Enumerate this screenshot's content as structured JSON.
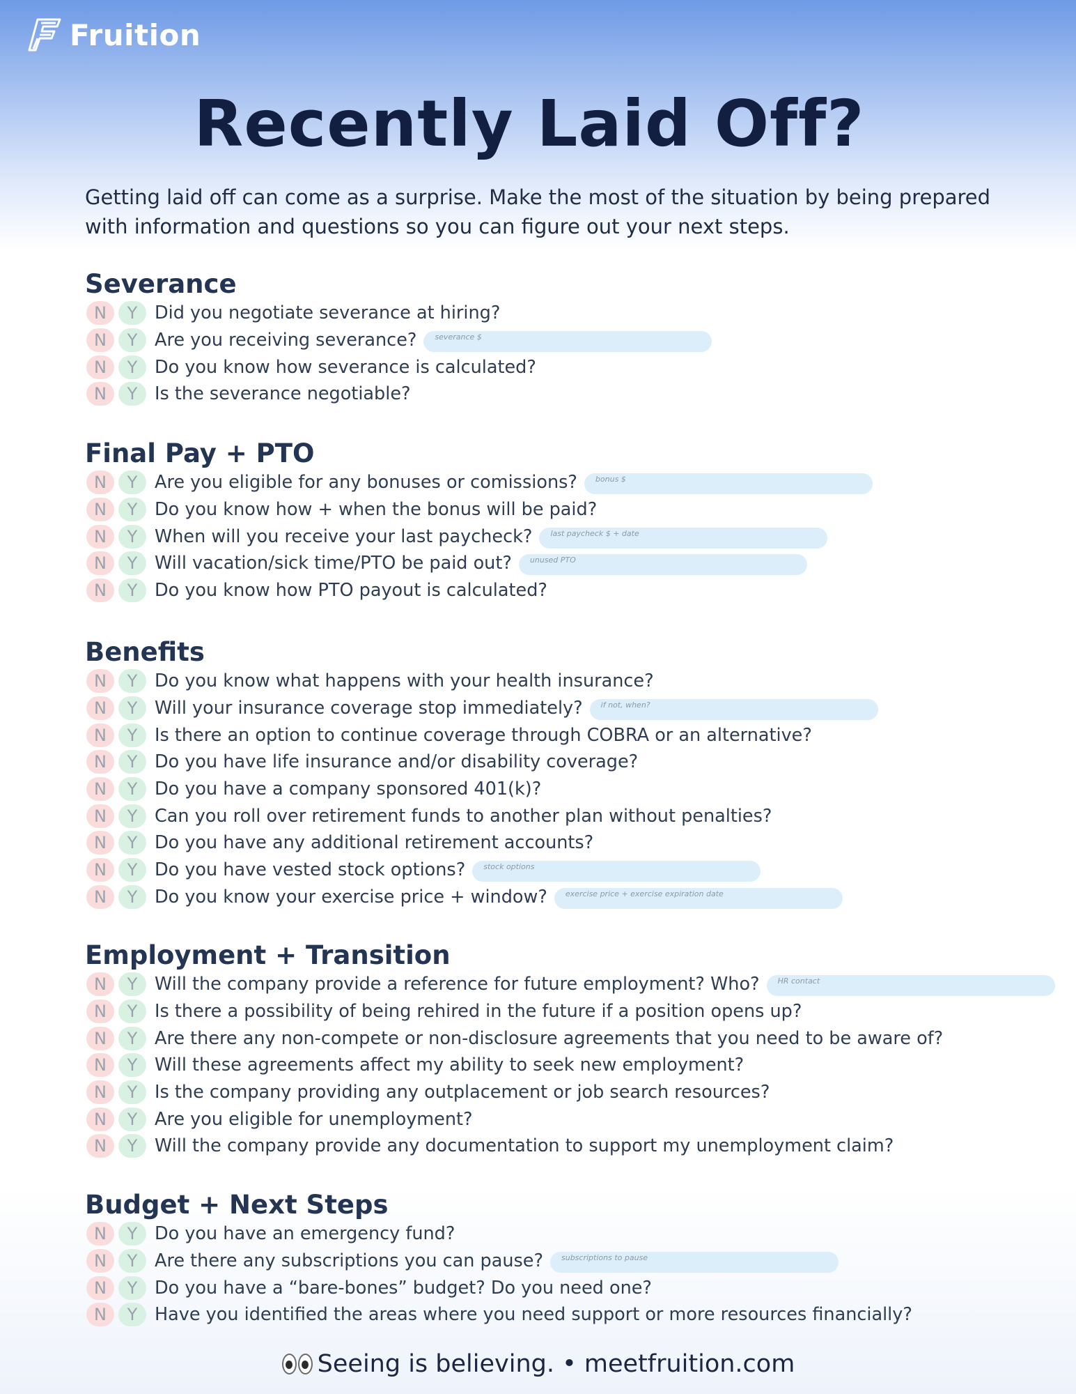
{
  "brand": {
    "name": "Fruition",
    "icon": "fruition-f-logo-icon"
  },
  "title": "Recently Laid Off?",
  "intro": "Getting laid off can come as a surprise. Make the most of the situation by being prepared with information and questions so you can figure out your next steps.",
  "chips": {
    "no": "N",
    "yes": "Y"
  },
  "sections": [
    {
      "heading": "Severance",
      "items": [
        {
          "q": "Did you negotiate severance at hiring?"
        },
        {
          "q": "Are you receiving severance?",
          "field": "severance $"
        },
        {
          "q": "Do you know how severance is calculated?"
        },
        {
          "q": "Is the severance negotiable?"
        }
      ]
    },
    {
      "heading": "Final Pay + PTO",
      "items": [
        {
          "q": "Are you eligible for any bonuses or comissions?",
          "field": "bonus $"
        },
        {
          "q": "Do you know how + when the bonus will be paid?"
        },
        {
          "q": "When will you receive your last paycheck?",
          "field": "last paycheck $ + date"
        },
        {
          "q": "Will vacation/sick time/PTO be paid out?",
          "field": "unused PTO"
        },
        {
          "q": "Do you know how PTO payout is calculated?"
        }
      ]
    },
    {
      "heading": "Benefits",
      "items": [
        {
          "q": "Do you know what happens with your health insurance?"
        },
        {
          "q": "Will your insurance coverage stop immediately?",
          "field": "if not, when?"
        },
        {
          "q": "Is there an option to continue coverage through COBRA or an alternative?"
        },
        {
          "q": "Do you have life insurance and/or disability coverage?"
        },
        {
          "q": "Do you have a company sponsored 401(k)?"
        },
        {
          "q": "Can you roll over retirement funds to another plan without penalties?"
        },
        {
          "q": "Do you have any additional retirement accounts?"
        },
        {
          "q": "Do you have vested stock options?",
          "field": "stock options"
        },
        {
          "q": "Do you know your exercise price + window?",
          "field": "exercise price + exercise expiration date"
        }
      ]
    },
    {
      "heading": "Employment + Transition",
      "items": [
        {
          "q": "Will the company provide a reference for future employment? Who?",
          "field": "HR contact"
        },
        {
          "q": "Is there a possibility of being rehired in the future if a position opens up?"
        },
        {
          "q": "Are there any non-compete or non-disclosure agreements that you need to be aware of?"
        },
        {
          "q": "Will these agreements affect my ability to seek new employment?"
        },
        {
          "q": "Is the company providing any outplacement or job search resources?"
        },
        {
          "q": "Are you eligible for unemployment?"
        },
        {
          "q": "Will the company provide any documentation to support my unemployment claim?"
        }
      ]
    },
    {
      "heading": "Budget + Next Steps",
      "items": [
        {
          "q": "Do you have an emergency fund?"
        },
        {
          "q": "Are there any subscriptions you can pause?",
          "field": "subscriptions to pause"
        },
        {
          "q": "Do you have a “bare-bones” budget? Do you need one?"
        },
        {
          "q": "Have you identified the areas where you need support or more resources financially?"
        }
      ]
    }
  ],
  "footer": {
    "text": "Seeing is believing. • meetfruition.com",
    "icon": "eyes-emoji-icon"
  }
}
